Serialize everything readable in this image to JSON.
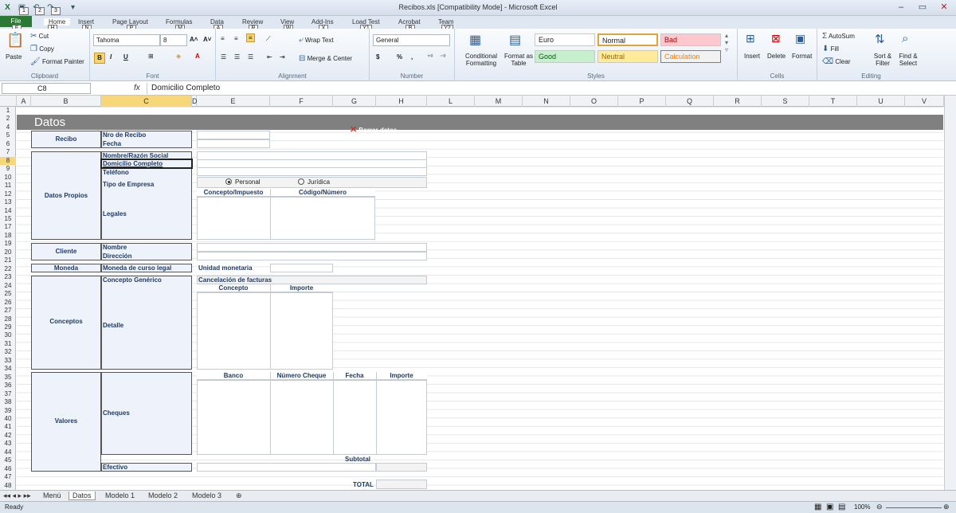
{
  "window": {
    "title": "Recibos.xls  [Compatibility Mode]  -  Microsoft Excel"
  },
  "ribbon_tabs": [
    {
      "label": "File",
      "key": "F"
    },
    {
      "label": "Home",
      "key": "H"
    },
    {
      "label": "Insert",
      "key": "N"
    },
    {
      "label": "Page Layout",
      "key": "P"
    },
    {
      "label": "Formulas",
      "key": "M"
    },
    {
      "label": "Data",
      "key": "A"
    },
    {
      "label": "Review",
      "key": "R"
    },
    {
      "label": "View",
      "key": "W"
    },
    {
      "label": "Add-Ins",
      "key": "X"
    },
    {
      "label": "Load Test",
      "key": "Y1"
    },
    {
      "label": "Acrobat",
      "key": "B"
    },
    {
      "label": "Team",
      "key": "Y2"
    }
  ],
  "qat_keys": [
    "1",
    "2",
    "3"
  ],
  "clipboard": {
    "paste": "Paste",
    "cut": "Cut",
    "copy": "Copy",
    "format_painter": "Format Painter",
    "label": "Clipboard"
  },
  "font": {
    "name": "Tahoma",
    "size": "8",
    "bold": "B",
    "italic": "I",
    "underline": "U",
    "label": "Font"
  },
  "alignment": {
    "wrap": "Wrap Text",
    "merge": "Merge & Center",
    "label": "Alignment"
  },
  "number": {
    "format": "General",
    "currency": "$",
    "percent": "%",
    "comma": ",",
    "label": "Number"
  },
  "styles": {
    "conditional": "Conditional Formatting",
    "format_table": "Format as Table",
    "cells": [
      {
        "label": "Euro",
        "bg": "#ffffff",
        "fg": "#222222"
      },
      {
        "label": "Normal",
        "bg": "#ffffff",
        "fg": "#222222"
      },
      {
        "label": "Bad",
        "bg": "#ffc7ce",
        "fg": "#9c0006"
      },
      {
        "label": "Good",
        "bg": "#c6efce",
        "fg": "#006100"
      },
      {
        "label": "Neutral",
        "bg": "#ffeb9c",
        "fg": "#9c6500"
      },
      {
        "label": "Calculation",
        "bg": "#f2f2f2",
        "fg": "#fa7d00"
      }
    ],
    "label": "Styles"
  },
  "cells_group": {
    "insert": "Insert",
    "delete": "Delete",
    "format": "Format",
    "label": "Cells"
  },
  "editing": {
    "autosum": "AutoSum",
    "fill": "Fill",
    "clear": "Clear",
    "sort": "Sort & Filter",
    "find": "Find & Select",
    "label": "Editing"
  },
  "formula_bar": {
    "name_box": "C8",
    "fx": "fx",
    "content": "Domicilio Completo"
  },
  "columns": [
    "A",
    "B",
    "C",
    "D",
    "E",
    "F",
    "G",
    "H",
    "L",
    "M",
    "N",
    "O",
    "P",
    "Q",
    "R",
    "S",
    "T",
    "U",
    "V"
  ],
  "rows": [
    "1",
    "2",
    "4",
    "5",
    "6",
    "7",
    "8",
    "9",
    "10",
    "11",
    "12",
    "13",
    "14",
    "15",
    "17",
    "18",
    "19",
    "20",
    "21",
    "22",
    "23",
    "24",
    "25",
    "26",
    "27",
    "28",
    "29",
    "30",
    "31",
    "32",
    "33",
    "34",
    "35",
    "36",
    "37",
    "38",
    "39",
    "40",
    "41",
    "42",
    "43",
    "44",
    "45",
    "46",
    "47",
    "48"
  ],
  "sheet": {
    "banner": "Datos",
    "borrar": "Borrar datos",
    "sections": {
      "recibo": "Recibo",
      "datos_propios": "Datos Propios",
      "cliente": "Cliente",
      "moneda": "Moneda",
      "conceptos": "Conceptos",
      "valores": "Valores"
    },
    "fields": {
      "nro_recibo": "Nro de Recibo",
      "fecha": "Fecha",
      "nombre_razon": "Nombre/Razón Social",
      "domicilio": "Domicilio Completo",
      "telefono": "Teléfono",
      "tipo_empresa": "Tipo de Empresa",
      "legales": "Legales",
      "cli_nombre": "Nombre",
      "cli_direccion": "Dirección",
      "moneda_legal": "Moneda de curso legal",
      "unidad_monetaria": "Unidad monetaria",
      "concepto_generico": "Concepto Genérico",
      "cancelacion": "Cancelación de facturas",
      "detalle": "Detalle",
      "cheques": "Cheques",
      "efectivo": "Efectivo",
      "subtotal": "Subtotal",
      "total": "TOTAL"
    },
    "radio_personal": "Personal",
    "radio_juridica": "Jurídica",
    "legales_headers": [
      "Concepto/Impuesto",
      "Código/Número"
    ],
    "detalle_headers": [
      "Concepto",
      "Importe"
    ],
    "cheques_headers": [
      "Banco",
      "Número Cheque",
      "Fecha",
      "Importe"
    ]
  },
  "sheet_tabs": [
    "Menú",
    "Datos",
    "Modelo 1",
    "Modelo 2",
    "Modelo 3"
  ],
  "status": {
    "ready": "Ready",
    "zoom": "100%"
  }
}
